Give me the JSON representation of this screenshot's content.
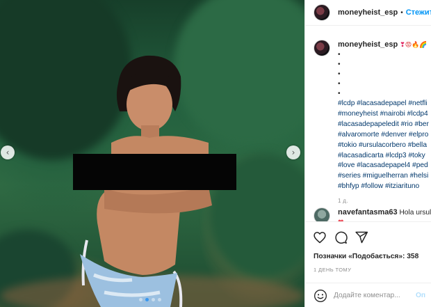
{
  "post": {
    "username": "moneyheist_esp",
    "separator": "•",
    "follow_label": "Стежити",
    "nav": {
      "prev_icon": "chevron-left-icon",
      "next_icon": "chevron-right-icon"
    },
    "carousel": {
      "slides": 4,
      "active_index": 1
    }
  },
  "caption": {
    "username": "moneyheist_esp",
    "emojis": [
      "❣",
      "😡",
      "🔥",
      "🌈"
    ],
    "bullets": [
      "•",
      "•",
      "•",
      "•",
      "•"
    ],
    "hashtag_lines": [
      "#lcdp #lacasadepapel #netfli",
      "#moneyheist #nairobi #lcdp4",
      "#lacasadepapeledit #rio #ber",
      "#alvaromorte #denver #elpro",
      "#tokio #ursulacorbero #bella",
      "#lacasadicarta #lcdp3 #toky",
      "#love #lacasadepapel4 #ped",
      "#series #miguelherran #helsi",
      "#bhfyp #follow #itziarituno"
    ],
    "time": "1 д."
  },
  "comment": {
    "username": "navefantasma63",
    "text": "Hola ursula",
    "emoji": "❤"
  },
  "actions": {
    "like_icon": "heart-icon",
    "comment_icon": "comment-icon",
    "share_icon": "paper-plane-icon",
    "likes_label": "Позначки «Подобається»: 358",
    "post_time": "1 ДЕНЬ ТОМУ"
  },
  "add_comment": {
    "placeholder": "Додайте коментар...",
    "submit_label": "Оп",
    "emoji_icon": "smile-icon"
  },
  "colors": {
    "link": "#00376b",
    "follow": "#0095f6",
    "muted": "#8e8e8e",
    "censor": "#050505"
  }
}
